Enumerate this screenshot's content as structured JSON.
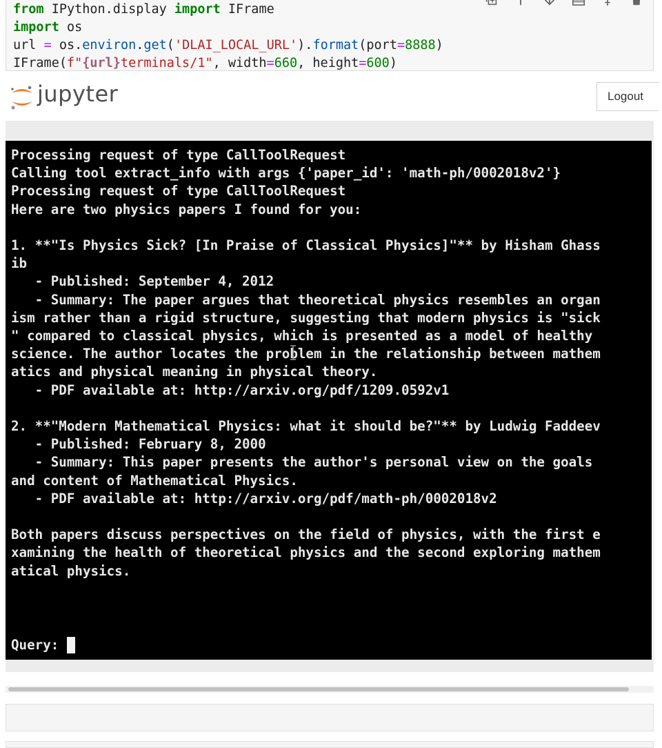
{
  "code_cell": {
    "line1": {
      "from": "from",
      "mod": " IPython.display ",
      "import": "import",
      "name": " IFrame"
    },
    "line2": {
      "import": "import",
      "name": " os"
    },
    "line3": {
      "a": "url ",
      "eq": "=",
      "b": " os.",
      "environ": "environ",
      "c": ".",
      "get": "get",
      "d": "(",
      "str": "'DLAI_LOCAL_URL'",
      "e": ").",
      "format": "format",
      "f": "(port",
      "eq2": "=",
      "num": "8888",
      "g": ")"
    },
    "line4": {
      "a": "IFrame(",
      "fpre": "f\"",
      "interp": "{url}",
      "fpost": "terminals/1\"",
      "b": ", width",
      "eq": "=",
      "w": "660",
      "c": ", height",
      "eq2": "=",
      "h": "600",
      "d": ")"
    }
  },
  "toolbar": {
    "icons": [
      "copy-icon",
      "arrow-up-icon",
      "arrow-down-icon",
      "insert-above-icon",
      "insert-below-icon",
      "trash-icon"
    ]
  },
  "header": {
    "brand": "jupyter",
    "logout_label": "Logout"
  },
  "terminal": {
    "output": "Processing request of type CallToolRequest\nCalling tool extract_info with args {'paper_id': 'math-ph/0002018v2'}\nProcessing request of type CallToolRequest\nHere are two physics papers I found for you:\n\n1. **\"Is Physics Sick? [In Praise of Classical Physics]\"** by Hisham Ghass\nib\n   - Published: September 4, 2012\n   - Summary: The paper argues that theoretical physics resembles an organ\nism rather than a rigid structure, suggesting that modern physics is \"sick\n\" compared to classical physics, which is presented as a model of healthy\nscience. The author locates the problem in the relationship between mathem\natics and physical meaning in physical theory.\n   - PDF available at: http://arxiv.org/pdf/1209.0592v1\n\n2. **\"Modern Mathematical Physics: what it should be?\"** by Ludwig Faddeev\n   - Published: February 8, 2000\n   - Summary: This paper presents the author's personal view on the goals\nand content of Mathematical Physics.\n   - PDF available at: http://arxiv.org/pdf/math-ph/0002018v2\n\nBoth papers discuss perspectives on the field of physics, with the first e\nxamining the health of theoretical physics and the second exploring mathem\natical physics.",
    "prompt": "Query:"
  },
  "colors": {
    "terminal_bg": "#000000",
    "terminal_fg": "#e8e8e8",
    "jupyter_orange": "#f37726",
    "keyword_green": "#008000",
    "string_red": "#ba2121"
  }
}
